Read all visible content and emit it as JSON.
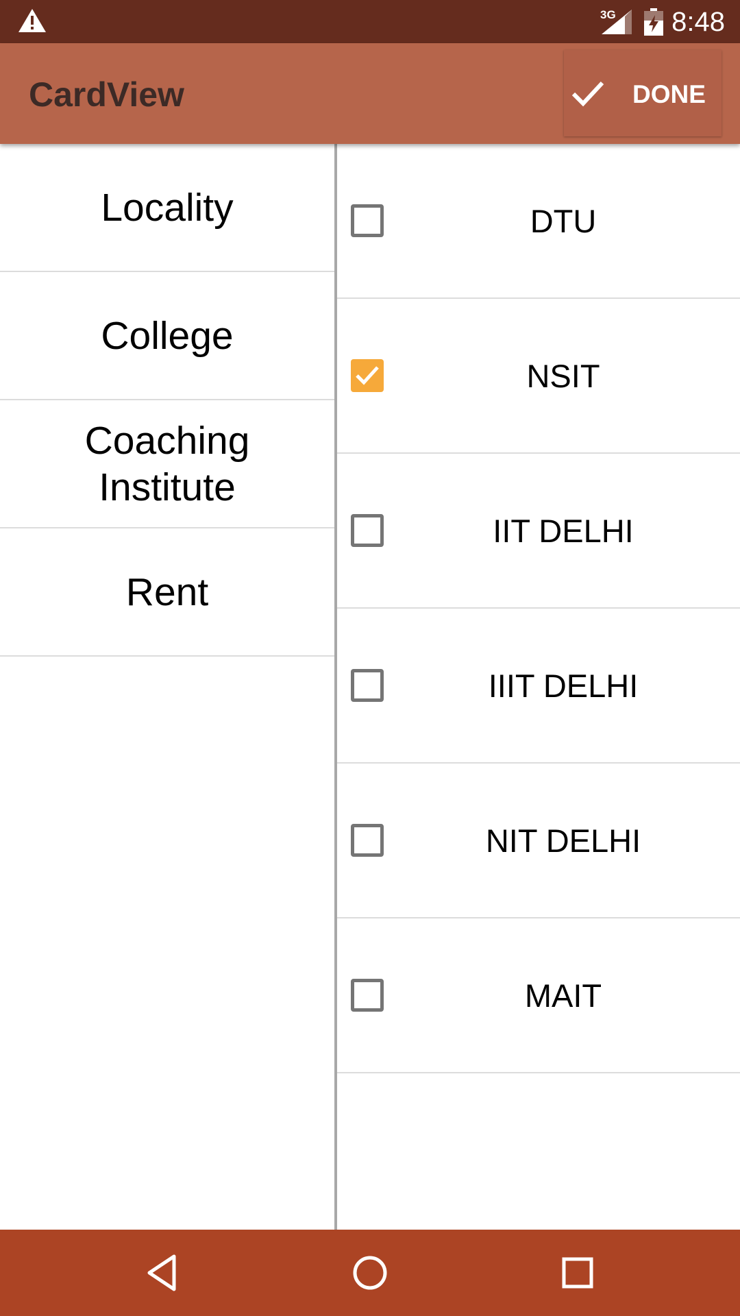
{
  "status_bar": {
    "network_label": "3G",
    "time": "8:48",
    "icons": [
      "warning-icon",
      "signal-icon",
      "battery-icon"
    ]
  },
  "app_bar": {
    "title": "CardView",
    "done_label": "DONE",
    "done_icon": "check-icon",
    "background_color": "#b6654b"
  },
  "categories": [
    {
      "label": "Locality"
    },
    {
      "label": "College"
    },
    {
      "label": "Coaching\nInstitute"
    },
    {
      "label": "Rent"
    }
  ],
  "options": [
    {
      "label": "DTU",
      "checked": false
    },
    {
      "label": "NSIT",
      "checked": true
    },
    {
      "label": "IIT DELHI",
      "checked": false
    },
    {
      "label": "IIIT DELHI",
      "checked": false
    },
    {
      "label": "NIT DELHI",
      "checked": false
    },
    {
      "label": "MAIT",
      "checked": false
    }
  ],
  "colors": {
    "status_bar": "#652c1e",
    "nav_bar": "#ac4424",
    "checkbox_checked": "#f6a93a"
  },
  "nav_bar": {
    "icons": [
      "back-icon",
      "home-icon",
      "recents-icon"
    ]
  }
}
